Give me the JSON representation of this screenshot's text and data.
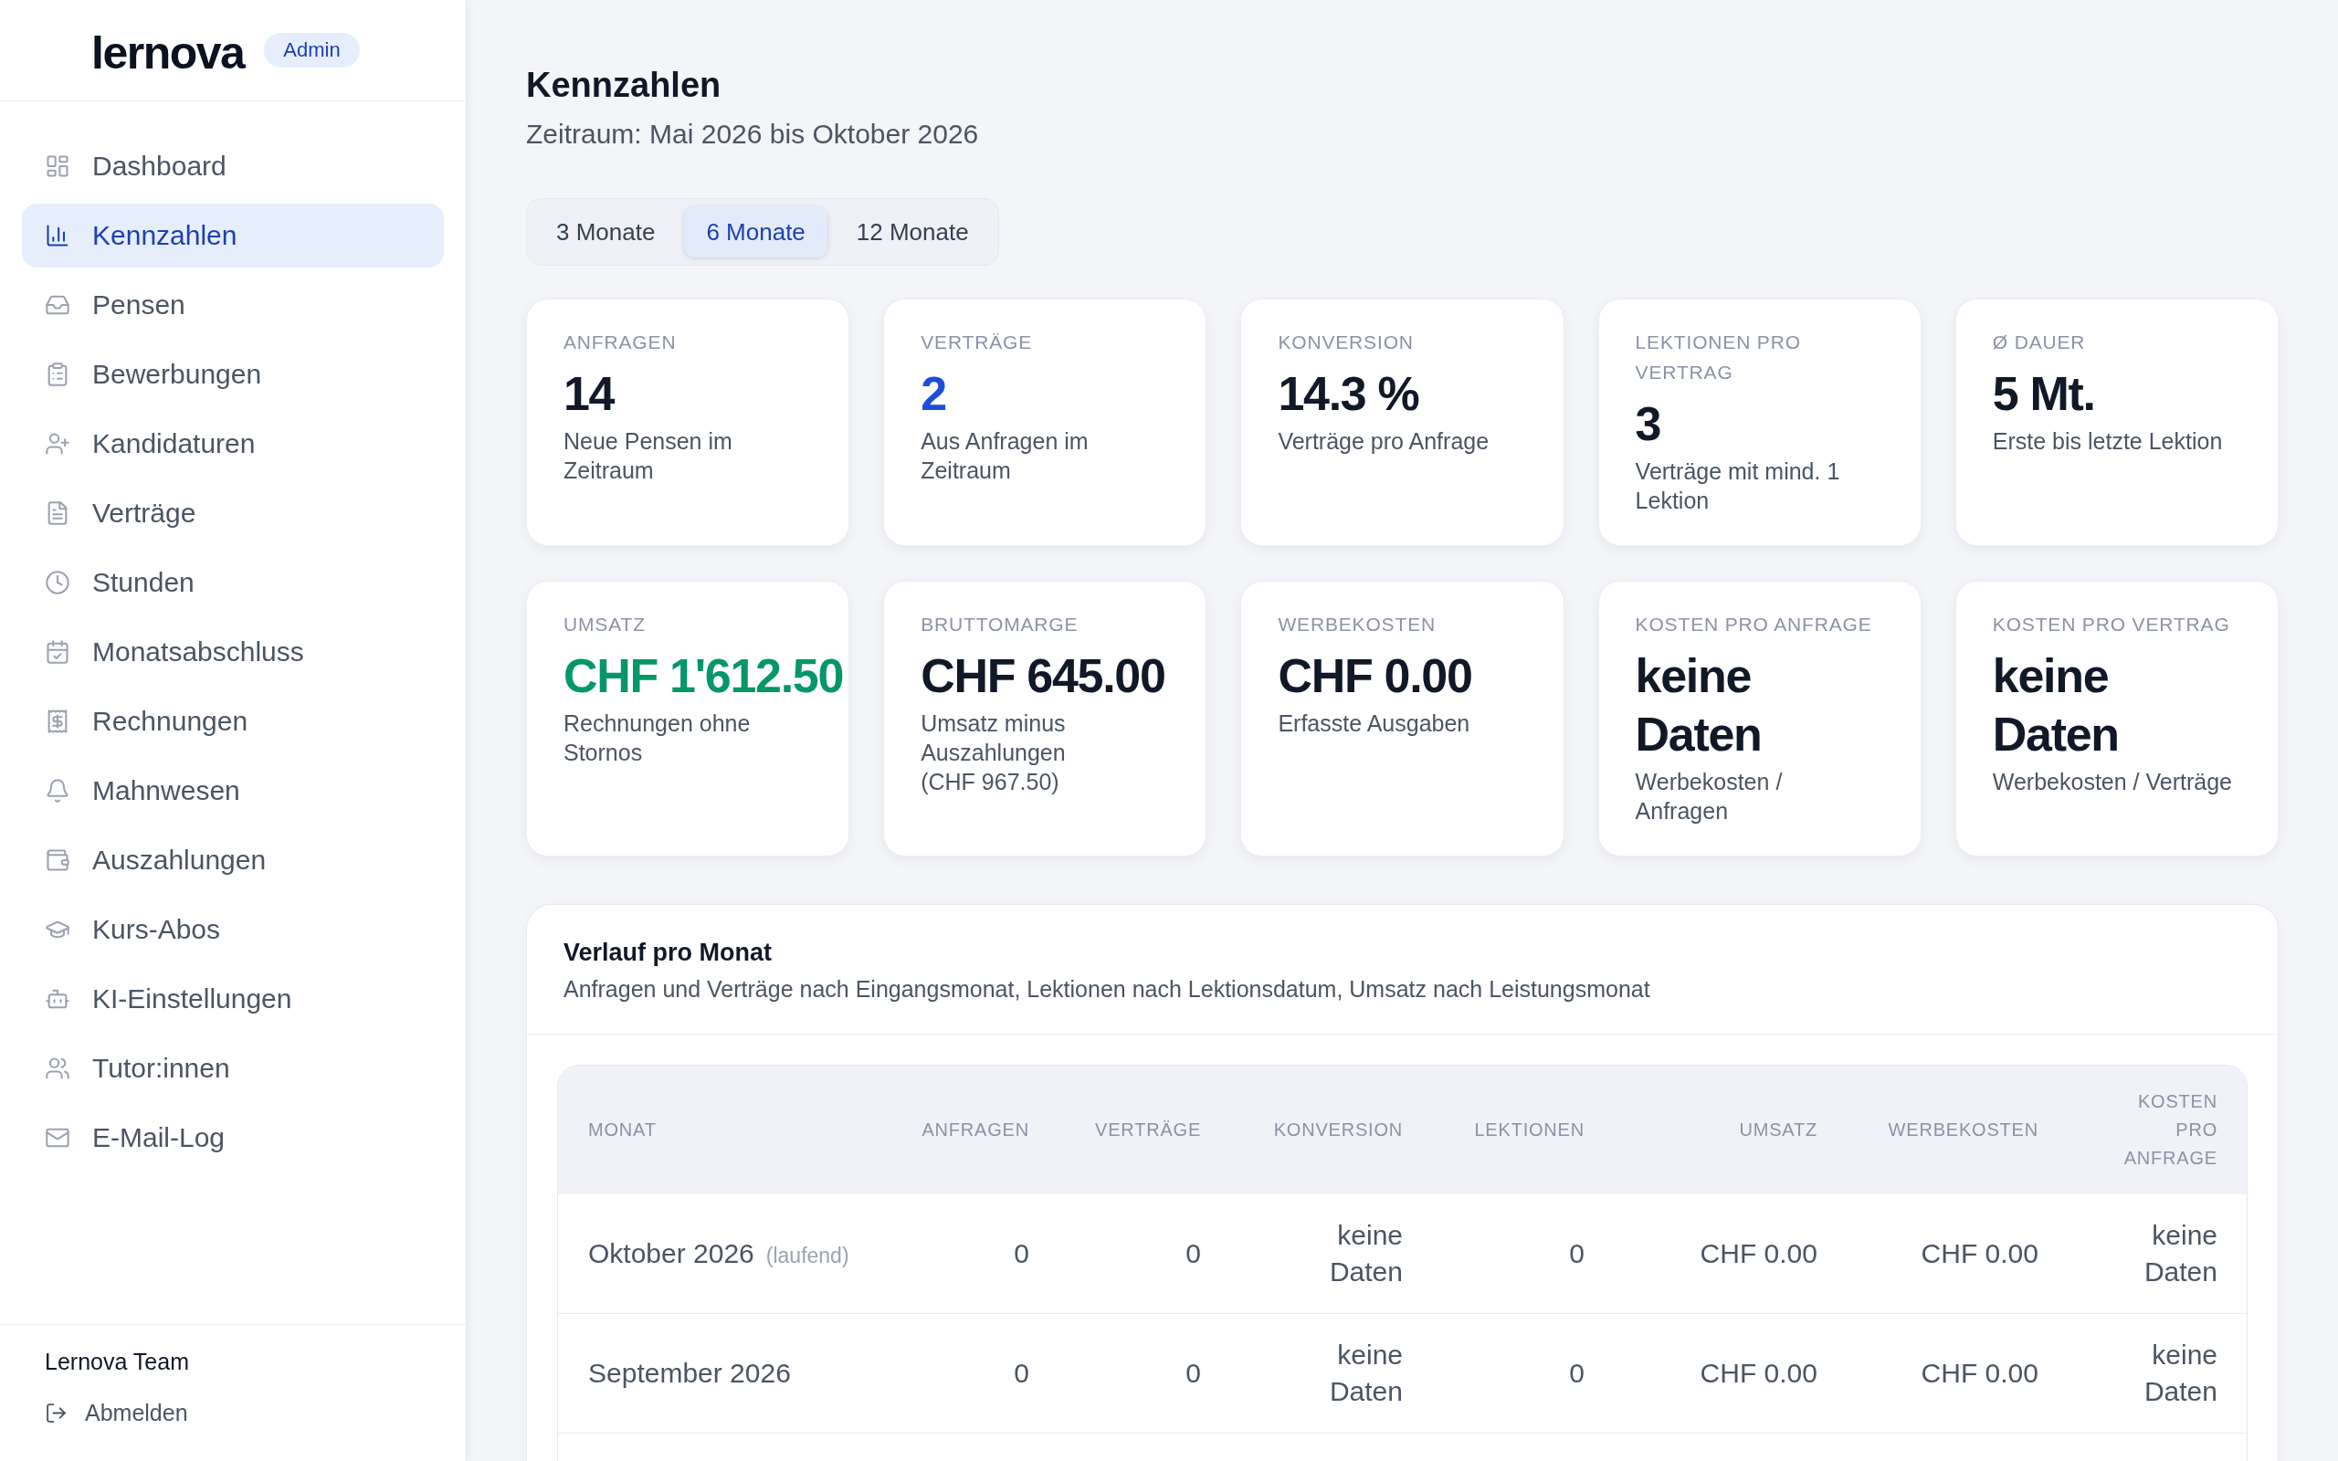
{
  "sidebar": {
    "brand": "lernova",
    "badge": "Admin",
    "items": [
      {
        "label": "Dashboard",
        "selected": false
      },
      {
        "label": "Kennzahlen",
        "selected": true
      },
      {
        "label": "Pensen",
        "selected": false
      },
      {
        "label": "Bewerbungen",
        "selected": false
      },
      {
        "label": "Kandidaturen",
        "selected": false
      },
      {
        "label": "Verträge",
        "selected": false
      },
      {
        "label": "Stunden",
        "selected": false
      },
      {
        "label": "Monatsabschluss",
        "selected": false
      },
      {
        "label": "Rechnungen",
        "selected": false
      },
      {
        "label": "Mahnwesen",
        "selected": false
      },
      {
        "label": "Auszahlungen",
        "selected": false
      },
      {
        "label": "Kurs-Abos",
        "selected": false
      },
      {
        "label": "KI-Einstellungen",
        "selected": false
      },
      {
        "label": "Tutor:innen",
        "selected": false
      },
      {
        "label": "E-Mail-Log",
        "selected": false
      }
    ],
    "footer": {
      "user": "Lernova Team",
      "logout": "Abmelden"
    }
  },
  "header": {
    "title": "Kennzahlen",
    "subtitle": "Zeitraum: Mai 2026 bis Oktober 2026"
  },
  "period_tabs": [
    {
      "label": "3 Monate",
      "selected": false
    },
    {
      "label": "6 Monate",
      "selected": true
    },
    {
      "label": "12 Monate",
      "selected": false
    }
  ],
  "kpi_cards": [
    {
      "kind": "figure",
      "label": "ANFRAGEN",
      "value": "14",
      "color": "#111827",
      "description": "Neue Pensen im Zeitraum"
    },
    {
      "kind": "figure",
      "label": "VERTRÄGE",
      "value": "2",
      "color": "#1d4ed8",
      "description": "Aus Anfragen im Zeitraum"
    },
    {
      "kind": "figure",
      "label": "KONVERSION",
      "value": "14.3 %",
      "color": "#111827",
      "description": "Verträge pro Anfrage"
    },
    {
      "kind": "figure",
      "label": "LEKTIONEN PRO VERTRAG",
      "value": "3",
      "color": "#111827",
      "description": "Verträge mit mind. 1 Lektion"
    },
    {
      "kind": "figure",
      "label": "Ø DAUER",
      "value": "5 Mt.",
      "color": "#111827",
      "description": "Erste bis letzte Lektion"
    },
    {
      "kind": "figure",
      "label": "UMSATZ",
      "value": "CHF 1'612.50",
      "color": "#059669",
      "description": "Rechnungen ohne Stornos"
    },
    {
      "kind": "figure",
      "label": "BRUTTOMARGE",
      "value": "CHF 645.00",
      "color": "#111827",
      "description": "Umsatz minus Auszahlungen",
      "detail": "(CHF 967.50)"
    },
    {
      "kind": "figure",
      "label": "WERBEKOSTEN",
      "value": "CHF 0.00",
      "color": "#111827",
      "description": "Erfasste Ausgaben"
    },
    {
      "kind": "empty",
      "label": "KOSTEN PRO ANFRAGE",
      "value": "keine Daten",
      "color": "#111827",
      "description": "Werbekosten / Anfragen"
    },
    {
      "kind": "empty",
      "label": "KOSTEN PRO VERTRAG",
      "value": "keine Daten",
      "color": "#111827",
      "description": "Werbekosten / Verträge"
    }
  ],
  "monthly_table": {
    "title": "Verlauf pro Monat",
    "subtitle": "Anfragen und Verträge nach Eingangsmonat, Lektionen nach Lektionsdatum, Umsatz nach Leistungsmonat",
    "columns": [
      "MONAT",
      "ANFRAGEN",
      "VERTRÄGE",
      "KONVERSION",
      "LEKTIONEN",
      "UMSATZ",
      "WERBEKOSTEN",
      "KOSTEN PRO ANFRAGE"
    ],
    "rows": [
      {
        "cells": [
          "Oktober 2026",
          "0",
          "0",
          "keine Daten",
          "0",
          "CHF 0.00",
          "CHF 0.00",
          "keine Daten"
        ],
        "note": "(laufend)"
      },
      {
        "cells": [
          "September 2026",
          "0",
          "0",
          "keine Daten",
          "0",
          "CHF 0.00",
          "CHF 0.00",
          "keine Daten"
        ]
      }
    ]
  }
}
